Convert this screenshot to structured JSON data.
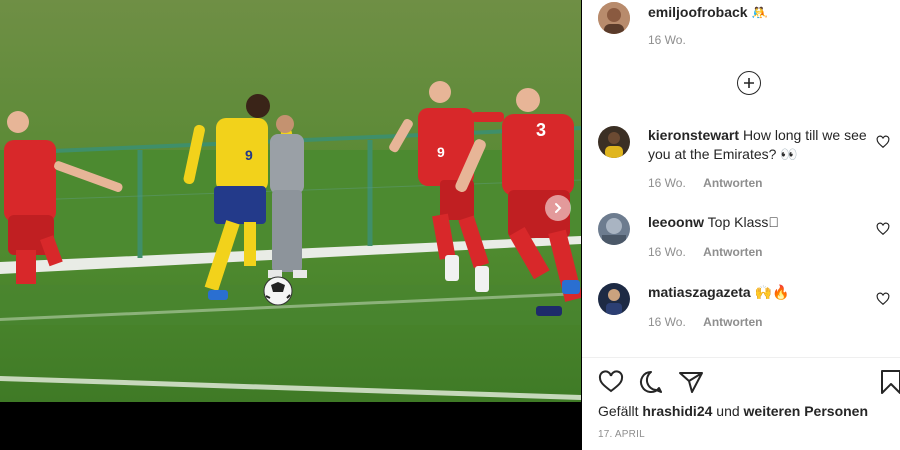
{
  "post": {
    "author": {
      "username": "emiljoofroback",
      "badge_emoji": "🤼",
      "age": "16 Wo."
    },
    "load_more_icon": "plus-circle-icon",
    "next_icon": "chevron-right-icon",
    "comments": [
      {
        "username": "kieronstewart",
        "text": "How long till we see you at the Emirates? 👀",
        "age": "16 Wo.",
        "reply_label": "Antworten"
      },
      {
        "username": "leeoonw",
        "text": "Top Klass􏿽",
        "age": "16 Wo.",
        "reply_label": "Antworten"
      },
      {
        "username": "matiaszagazeta",
        "text": "🙌🔥",
        "age": "16 Wo.",
        "reply_label": "Antworten"
      }
    ],
    "likes": {
      "prefix": "Gefällt",
      "user": "hrashidi24",
      "middle": "und",
      "suffix": "weiteren Personen"
    },
    "date": "17. APRIL",
    "colors": {
      "text": "#262626",
      "muted": "#8e8e8e",
      "pitch": "#4f8a2f",
      "home_kit": "#f2d21b",
      "away_kit": "#d8282a"
    }
  }
}
